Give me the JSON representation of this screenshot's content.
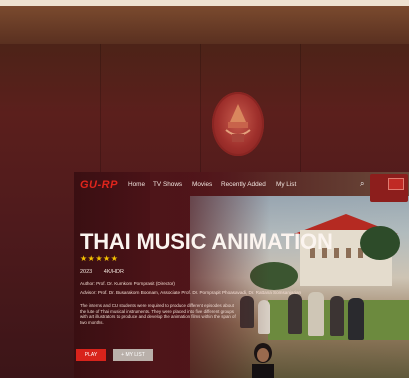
{
  "app": {
    "logo": "GU-RP"
  },
  "nav": {
    "items": [
      {
        "label": "Home"
      },
      {
        "label": "TV Shows"
      },
      {
        "label": "Movies"
      },
      {
        "label": "Recently Added"
      },
      {
        "label": "My List"
      }
    ],
    "search_icon": "search-icon"
  },
  "hero": {
    "title": "THAI MUSIC ANIMATION",
    "stars": "★★★★★",
    "rating": 5,
    "year": "2023",
    "quality": "4K/HDR",
    "author": "Author: Prof. Dr. Kumkom Pornprasit (Director)",
    "advisors": "Advisor: Prof. Dr. Busarakorn Boonam,  Associate Prof. Dr. Pornprapit Phoasavadi,  Dr. Rattana Somsanjarian",
    "description": "The interns and CU students were required to produce different episodes about the lute of Thai musical instruments. They were placed into five different groups with art illustrators to produce and develop the animation films within the span of two months."
  },
  "buttons": {
    "play": "PLAY",
    "my_list": "+ MY LIST"
  },
  "colors": {
    "brand": "#e0251c",
    "star": "#f6c200",
    "wall": "#5b1f1c"
  }
}
